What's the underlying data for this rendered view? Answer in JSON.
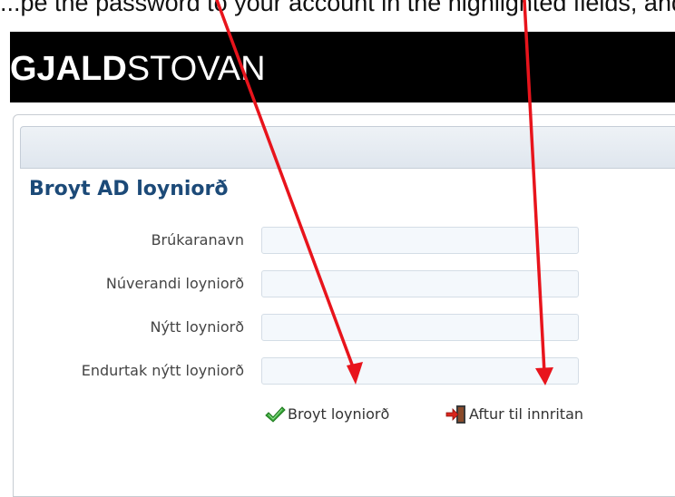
{
  "intro": {
    "text": "...pe the password to your account in the highlighted fields, and click"
  },
  "header": {
    "logo_bold": "GJALD",
    "logo_light": "STOVAN"
  },
  "form": {
    "title": "Broyt AD loyniorð",
    "fields": [
      {
        "label": "Brúkaranavn",
        "value": ""
      },
      {
        "label": "Núverandi loyniorð",
        "value": ""
      },
      {
        "label": "Nýtt loyniorð",
        "value": ""
      },
      {
        "label": "Endurtak nýtt loyniorð",
        "value": ""
      }
    ],
    "actions": {
      "change_password": {
        "label": "Broyt loyniorð",
        "icon": "checkmark-icon"
      },
      "back_to_login": {
        "label": "Aftur til innritan",
        "icon": "exit-door-icon"
      }
    }
  },
  "annotation": {
    "arrow_color": "#e8141c"
  },
  "colors": {
    "title": "#1c4a78",
    "header_bg": "#000000",
    "input_bg": "#f4f8fc"
  }
}
